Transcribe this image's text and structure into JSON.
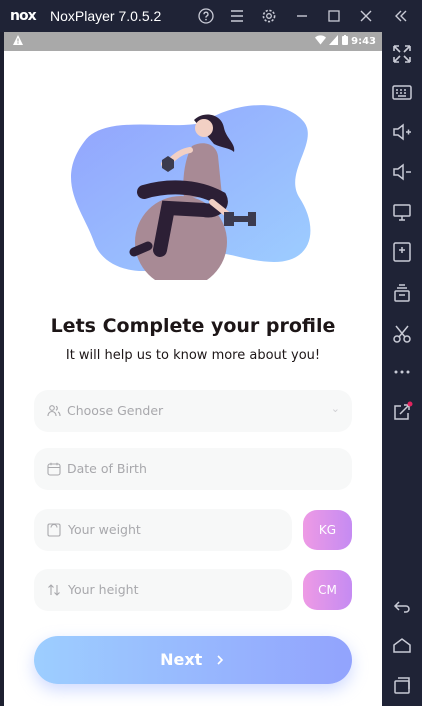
{
  "window": {
    "app_name": "NoxPlayer 7.0.5.2",
    "logo_text": "nox"
  },
  "status_bar": {
    "time": "9:43"
  },
  "profile": {
    "title": "Lets Complete your profile",
    "subtitle": "It will help us to know more about you!",
    "gender_placeholder": "Choose Gender",
    "dob_placeholder": "Date of Birth",
    "weight_placeholder": "Your weight",
    "weight_unit": "KG",
    "height_placeholder": "Your height",
    "height_unit": "CM",
    "next_label": "Next"
  },
  "colors": {
    "primary_gradient_start": "#9DCEFF",
    "primary_gradient_end": "#92A3FD",
    "secondary_gradient_start": "#EE9AE5",
    "secondary_gradient_end": "#C58BF2"
  }
}
